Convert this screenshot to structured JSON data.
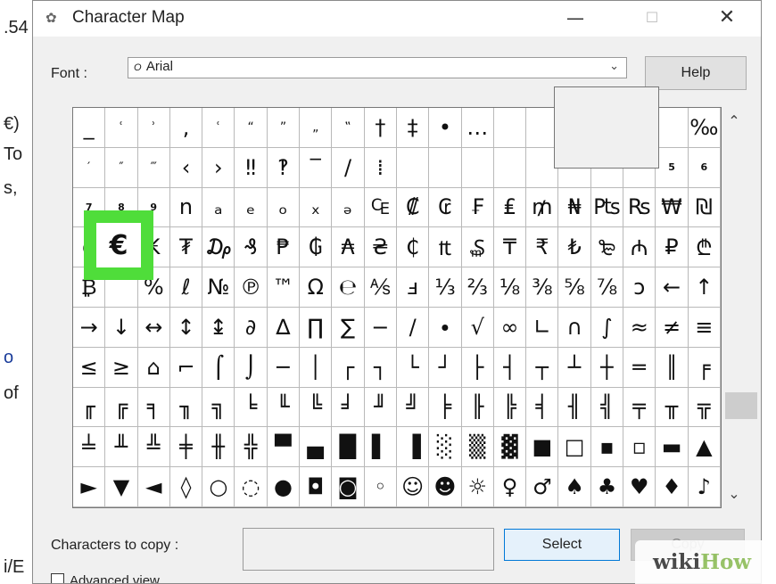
{
  "background_doc": {
    "fragments": [
      {
        "text": ".54",
        "blue": false
      },
      {
        "text": "€)",
        "blue": false
      },
      {
        "text": "To",
        "blue": false
      },
      {
        "text": "s,",
        "blue": false
      },
      {
        "text": "o",
        "blue": true
      },
      {
        "text": "of",
        "blue": false
      },
      {
        "text": "i/E",
        "blue": false
      }
    ]
  },
  "window": {
    "title": "Character Map",
    "app_icon": "character-map-icon",
    "controls": {
      "minimize": "—",
      "maximize": "☐",
      "close": "✕"
    }
  },
  "font_row": {
    "label": "Font :",
    "font_type_glyph": "O",
    "selected_font": "Arial",
    "dropdown_glyph": "⌄",
    "help_label": "Help"
  },
  "grid": {
    "rows": [
      [
        "_",
        "ʿ",
        "ʾ",
        ",",
        "ʿ",
        "“",
        "”",
        "„",
        "‟",
        "†",
        "‡",
        "•",
        "…",
        "",
        "",
        "",
        "",
        "",
        "",
        "‰"
      ],
      [
        "′",
        "″",
        "‴",
        "‹",
        "›",
        "‼",
        "‽",
        "‾",
        "/",
        "⁞",
        "",
        "",
        "",
        "",
        "",
        "",
        "",
        "",
        "5",
        "6"
      ],
      [
        "7",
        "8",
        "9",
        "n",
        "ₐ",
        "ₑ",
        "ₒ",
        "ₓ",
        "ₔ",
        "₠",
        "₡",
        "₢",
        "₣",
        "₤",
        "₥",
        "₦",
        "₧",
        "₨",
        "₩",
        "₪"
      ],
      [
        "₫",
        "€",
        "₭",
        "₮",
        "₯",
        "₰",
        "₱",
        "₲",
        "₳",
        "₴",
        "₵",
        "₶",
        "₷",
        "₸",
        "₹",
        "₺",
        "₻",
        "₼",
        "₽",
        "₾"
      ],
      [
        "₿",
        "",
        "%",
        "ℓ",
        "№",
        "℗",
        "™",
        "Ω",
        "℮",
        "⅍",
        "ⅎ",
        "⅓",
        "⅔",
        "⅛",
        "⅜",
        "⅝",
        "⅞",
        "ↄ",
        "←",
        "↑"
      ],
      [
        "→",
        "↓",
        "↔",
        "↕",
        "↨",
        "∂",
        "∆",
        "∏",
        "∑",
        "−",
        "∕",
        "∙",
        "√",
        "∞",
        "∟",
        "∩",
        "∫",
        "≈",
        "≠",
        "≡"
      ],
      [
        "≤",
        "≥",
        "⌂",
        "⌐",
        "⌠",
        "⌡",
        "─",
        "│",
        "┌",
        "┐",
        "└",
        "┘",
        "├",
        "┤",
        "┬",
        "┴",
        "┼",
        "═",
        "║",
        "╒"
      ],
      [
        "╓",
        "╔",
        "╕",
        "╖",
        "╗",
        "╘",
        "╙",
        "╚",
        "╛",
        "╜",
        "╝",
        "╞",
        "╟",
        "╠",
        "╡",
        "╢",
        "╣",
        "╤",
        "╥",
        "╦"
      ],
      [
        "╧",
        "╨",
        "╩",
        "╪",
        "╫",
        "╬",
        "▀",
        "▄",
        "█",
        "▌",
        "▐",
        "░",
        "▒",
        "▓",
        "■",
        "□",
        "▪",
        "▫",
        "▬",
        "▲"
      ],
      [
        "►",
        "▼",
        "◄",
        "◊",
        "○",
        "◌",
        "●",
        "◘",
        "◙",
        "◦",
        "☺",
        "☻",
        "☼",
        "♀",
        "♂",
        "♠",
        "♣",
        "♥",
        "♦",
        "♪"
      ]
    ],
    "selected_char": "€"
  },
  "scrollbar": {
    "up": "⌃",
    "down": "⌄"
  },
  "bottom": {
    "copy_label": "Characters to copy :",
    "copy_value": "",
    "select_label": "Select",
    "copy_button_label": "Copy",
    "advanced_label": "Advanced view"
  },
  "watermark": {
    "part1": "wiki",
    "part2": "How"
  }
}
